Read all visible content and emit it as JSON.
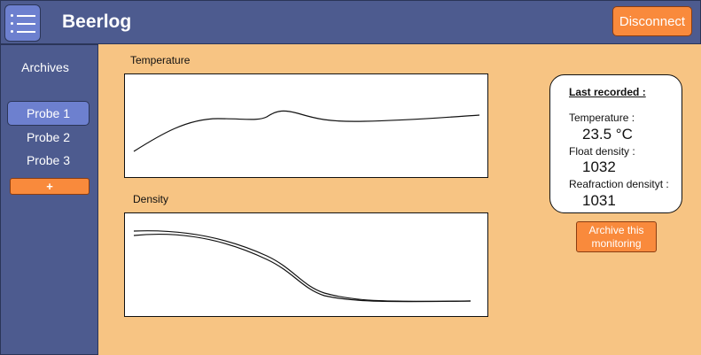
{
  "header": {
    "menu_icon": "list-menu-icon",
    "title": "Beerlog",
    "disconnect_label": "Disconnect"
  },
  "sidebar": {
    "archives_label": "Archives",
    "probes": [
      {
        "label": "Probe 1",
        "active": true
      },
      {
        "label": "Probe 2",
        "active": false
      },
      {
        "label": "Probe 3",
        "active": false
      }
    ],
    "add_label": "+"
  },
  "main": {
    "temperature_chart_label": "Temperature",
    "density_chart_label": "Density"
  },
  "last_recorded": {
    "title": "Last recorded :",
    "temperature_label": "Temperature :",
    "temperature_value": "23.5 °C",
    "float_density_label": "Float density :",
    "float_density_value": "1032",
    "refraction_density_label": "Reafraction densityt :",
    "refraction_density_value": "1031"
  },
  "archive_button_label": "Archive this monitoring",
  "colors": {
    "header_bg": "#4d5b8f",
    "active_item": "#6d80cf",
    "accent_orange": "#f98a3c",
    "page_bg": "#f7c483"
  }
}
